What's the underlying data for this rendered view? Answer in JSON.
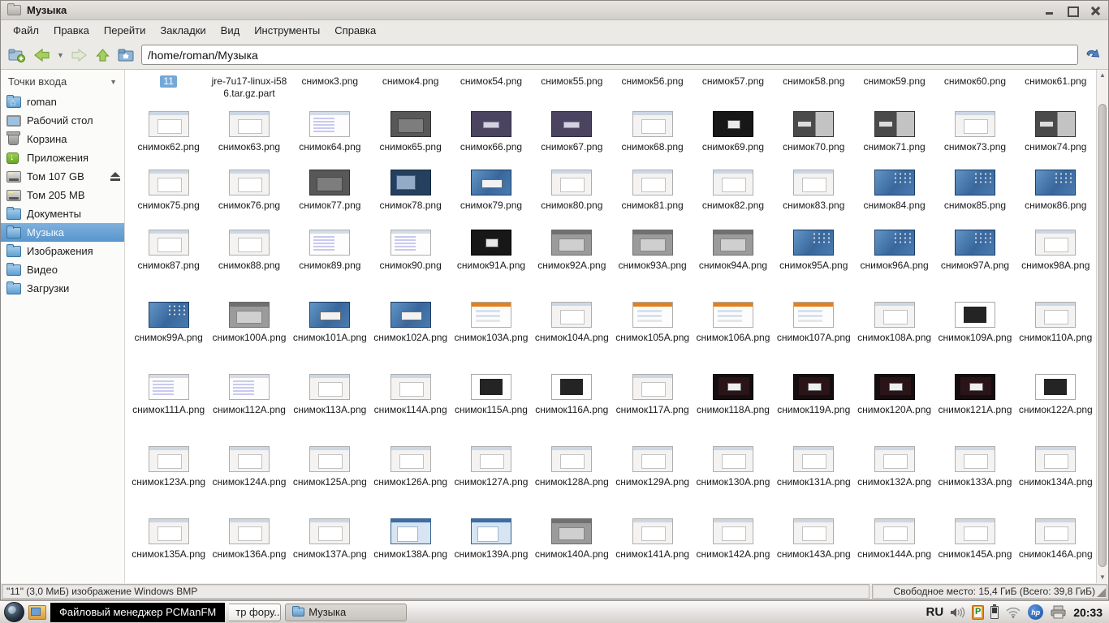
{
  "window": {
    "title": "Музыка"
  },
  "menubar": {
    "items": [
      "Файл",
      "Правка",
      "Перейти",
      "Закладки",
      "Вид",
      "Инструменты",
      "Справка"
    ]
  },
  "toolbar": {
    "path": "/home/roman/Музыка"
  },
  "sidebar": {
    "header": "Точки входа",
    "items": [
      {
        "id": "roman",
        "label": "roman",
        "icon": "home",
        "selected": false
      },
      {
        "id": "desktop",
        "label": "Рабочий стол",
        "icon": "desktop",
        "selected": false
      },
      {
        "id": "trash",
        "label": "Корзина",
        "icon": "trash",
        "selected": false
      },
      {
        "id": "applications",
        "label": "Приложения",
        "icon": "applications",
        "selected": false
      },
      {
        "id": "vol107",
        "label": "Том 107 GB",
        "icon": "drive",
        "selected": false,
        "eject": true
      },
      {
        "id": "vol205",
        "label": "Том 205 MB",
        "icon": "drive",
        "selected": false
      },
      {
        "id": "documents",
        "label": "Документы",
        "icon": "folder",
        "selected": false
      },
      {
        "id": "music",
        "label": "Музыка",
        "icon": "folder",
        "selected": true
      },
      {
        "id": "pictures",
        "label": "Изображения",
        "icon": "folder",
        "selected": false
      },
      {
        "id": "video",
        "label": "Видео",
        "icon": "folder",
        "selected": false
      },
      {
        "id": "downloads",
        "label": "Загрузки",
        "icon": "folder",
        "selected": false
      }
    ]
  },
  "filegrid": {
    "rows": [
      [
        {
          "name": "11",
          "thumb": "none",
          "selected": true
        },
        {
          "name": "jre-7u17-linux-i586.tar.gz.part",
          "thumb": "none"
        },
        {
          "name": "снимок3.png",
          "thumb": "none"
        },
        {
          "name": "снимок4.png",
          "thumb": "none"
        },
        {
          "name": "снимок54.png",
          "thumb": "none"
        },
        {
          "name": "снимок55.png",
          "thumb": "none"
        },
        {
          "name": "снимок56.png",
          "thumb": "none"
        },
        {
          "name": "снимок57.png",
          "thumb": "none"
        },
        {
          "name": "снимок58.png",
          "thumb": "none"
        },
        {
          "name": "снимок59.png",
          "thumb": "none"
        },
        {
          "name": "снимок60.png",
          "thumb": "none"
        },
        {
          "name": "снимок61.png",
          "thumb": "none"
        }
      ],
      [
        {
          "name": "снимок62.png",
          "thumb": "light"
        },
        {
          "name": "снимок63.png",
          "thumb": "light"
        },
        {
          "name": "снимок64.png",
          "thumb": "lav"
        },
        {
          "name": "снимок65.png",
          "thumb": "dark"
        },
        {
          "name": "снимок66.png",
          "thumb": "purple"
        },
        {
          "name": "снимок67.png",
          "thumb": "purple"
        },
        {
          "name": "снимок68.png",
          "thumb": "light"
        },
        {
          "name": "снимок69.png",
          "thumb": "black"
        },
        {
          "name": "снимок70.png",
          "thumb": "darkmix"
        },
        {
          "name": "снимок71.png",
          "thumb": "darkmix"
        },
        {
          "name": "снимок73.png",
          "thumb": "light"
        },
        {
          "name": "снимок74.png",
          "thumb": "darkmix"
        }
      ],
      [
        {
          "name": "снимок75.png",
          "thumb": "light"
        },
        {
          "name": "снимок76.png",
          "thumb": "light"
        },
        {
          "name": "снимок77.png",
          "thumb": "dark"
        },
        {
          "name": "снимок78.png",
          "thumb": "darkblue"
        },
        {
          "name": "снимок79.png",
          "thumb": "bluedlg"
        },
        {
          "name": "снимок80.png",
          "thumb": "light"
        },
        {
          "name": "снимок81.png",
          "thumb": "light"
        },
        {
          "name": "снимок82.png",
          "thumb": "light"
        },
        {
          "name": "снимок83.png",
          "thumb": "light"
        },
        {
          "name": "снимок84.png",
          "thumb": "bluedesk"
        },
        {
          "name": "снимок85.png",
          "thumb": "bluedesk"
        },
        {
          "name": "снимок86.png",
          "thumb": "bluedesk"
        }
      ],
      [
        {
          "name": "снимок87.png",
          "thumb": "light"
        },
        {
          "name": "снимок88.png",
          "thumb": "light"
        },
        {
          "name": "снимок89.png",
          "thumb": "lav"
        },
        {
          "name": "снимок90.png",
          "thumb": "lav"
        },
        {
          "name": "снимок91A.png",
          "thumb": "black"
        },
        {
          "name": "снимок92A.png",
          "thumb": "gray"
        },
        {
          "name": "снимок93A.png",
          "thumb": "gray"
        },
        {
          "name": "снимок94A.png",
          "thumb": "gray"
        },
        {
          "name": "снимок95A.png",
          "thumb": "bluedesk"
        },
        {
          "name": "снимок96A.png",
          "thumb": "bluedesk"
        },
        {
          "name": "снимок97A.png",
          "thumb": "bluedesk"
        },
        {
          "name": "снимок98A.png",
          "thumb": "light"
        }
      ],
      [
        {
          "name": "снимок99A.png",
          "thumb": "bluedesk"
        },
        {
          "name": "снимок100A.png",
          "thumb": "gray"
        },
        {
          "name": "снимок101A.png",
          "thumb": "bluedlg"
        },
        {
          "name": "снимок102A.png",
          "thumb": "bluedlg"
        },
        {
          "name": "снимок103A.png",
          "thumb": "orange"
        },
        {
          "name": "снимок104A.png",
          "thumb": "light"
        },
        {
          "name": "снимок105A.png",
          "thumb": "orange"
        },
        {
          "name": "снимок106A.png",
          "thumb": "orange"
        },
        {
          "name": "снимок107A.png",
          "thumb": "orange"
        },
        {
          "name": "снимок108A.png",
          "thumb": "light"
        },
        {
          "name": "снимок109A.png",
          "thumb": "darkframe"
        },
        {
          "name": "снимок110A.png",
          "thumb": "light"
        }
      ],
      [
        {
          "name": "снимок111A.png",
          "thumb": "lav"
        },
        {
          "name": "снимок112A.png",
          "thumb": "lav"
        },
        {
          "name": "снимок113A.png",
          "thumb": "light"
        },
        {
          "name": "снимок114A.png",
          "thumb": "light"
        },
        {
          "name": "снимок115A.png",
          "thumb": "darkframe"
        },
        {
          "name": "снимок116A.png",
          "thumb": "darkframe"
        },
        {
          "name": "снимок117A.png",
          "thumb": "light"
        },
        {
          "name": "снимок118A.png",
          "thumb": "darkred"
        },
        {
          "name": "снимок119A.png",
          "thumb": "darkred"
        },
        {
          "name": "снимок120A.png",
          "thumb": "darkred"
        },
        {
          "name": "снимок121A.png",
          "thumb": "darkred"
        },
        {
          "name": "снимок122A.png",
          "thumb": "darkframe"
        }
      ],
      [
        {
          "name": "снимок123A.png",
          "thumb": "light"
        },
        {
          "name": "снимок124A.png",
          "thumb": "light"
        },
        {
          "name": "снимок125A.png",
          "thumb": "light"
        },
        {
          "name": "снимок126A.png",
          "thumb": "light"
        },
        {
          "name": "снимок127A.png",
          "thumb": "light"
        },
        {
          "name": "снимок128A.png",
          "thumb": "light"
        },
        {
          "name": "снимок129A.png",
          "thumb": "light"
        },
        {
          "name": "снимок130A.png",
          "thumb": "light"
        },
        {
          "name": "снимок131A.png",
          "thumb": "light"
        },
        {
          "name": "снимок132A.png",
          "thumb": "light"
        },
        {
          "name": "снимок133A.png",
          "thumb": "light"
        },
        {
          "name": "снимок134A.png",
          "thumb": "light"
        }
      ],
      [
        {
          "name": "снимок135A.png",
          "thumb": "light"
        },
        {
          "name": "снимок136A.png",
          "thumb": "light"
        },
        {
          "name": "снимок137A.png",
          "thumb": "light"
        },
        {
          "name": "снимок138A.png",
          "thumb": "bluewin"
        },
        {
          "name": "снимок139A.png",
          "thumb": "bluewin"
        },
        {
          "name": "снимок140A.png",
          "thumb": "gray"
        },
        {
          "name": "снимок141A.png",
          "thumb": "light"
        },
        {
          "name": "снимок142A.png",
          "thumb": "light"
        },
        {
          "name": "снимок143A.png",
          "thumb": "light"
        },
        {
          "name": "снимок144A.png",
          "thumb": "light"
        },
        {
          "name": "снимок145A.png",
          "thumb": "light"
        },
        {
          "name": "снимок146A.png",
          "thumb": "light"
        }
      ]
    ]
  },
  "statusbar": {
    "left": "\"11\" (3,0 МиБ) изображение Windows BMP",
    "right": "Свободное место: 15,4 ГиБ (Всего: 39,8 ГиБ)"
  },
  "taskbar": {
    "tooltip": "Файловый менеджер PCManFM",
    "button_cut": "тр фору...",
    "button_active": "Музыка",
    "keyboard_layout": "RU",
    "clock": "20:33",
    "tray_icons": [
      "volume-icon",
      "clipboard-manager-icon",
      "battery-icon",
      "wifi-icon",
      "hp-monitor-icon",
      "printer-icon"
    ]
  }
}
